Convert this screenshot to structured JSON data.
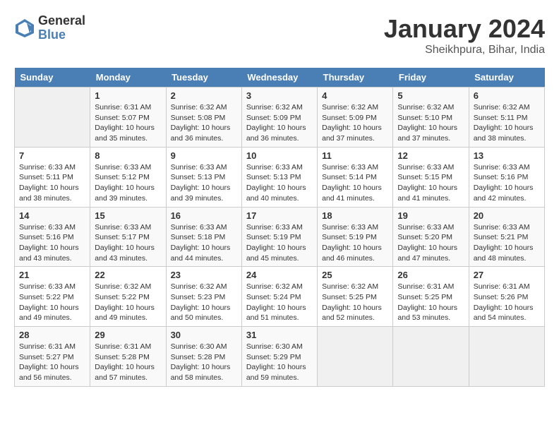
{
  "header": {
    "logo_general": "General",
    "logo_blue": "Blue",
    "month_year": "January 2024",
    "location": "Sheikhpura, Bihar, India"
  },
  "calendar": {
    "days_of_week": [
      "Sunday",
      "Monday",
      "Tuesday",
      "Wednesday",
      "Thursday",
      "Friday",
      "Saturday"
    ],
    "weeks": [
      [
        {
          "day": "",
          "info": ""
        },
        {
          "day": "1",
          "info": "Sunrise: 6:31 AM\nSunset: 5:07 PM\nDaylight: 10 hours\nand 35 minutes."
        },
        {
          "day": "2",
          "info": "Sunrise: 6:32 AM\nSunset: 5:08 PM\nDaylight: 10 hours\nand 36 minutes."
        },
        {
          "day": "3",
          "info": "Sunrise: 6:32 AM\nSunset: 5:09 PM\nDaylight: 10 hours\nand 36 minutes."
        },
        {
          "day": "4",
          "info": "Sunrise: 6:32 AM\nSunset: 5:09 PM\nDaylight: 10 hours\nand 37 minutes."
        },
        {
          "day": "5",
          "info": "Sunrise: 6:32 AM\nSunset: 5:10 PM\nDaylight: 10 hours\nand 37 minutes."
        },
        {
          "day": "6",
          "info": "Sunrise: 6:32 AM\nSunset: 5:11 PM\nDaylight: 10 hours\nand 38 minutes."
        }
      ],
      [
        {
          "day": "7",
          "info": "Sunrise: 6:33 AM\nSunset: 5:11 PM\nDaylight: 10 hours\nand 38 minutes."
        },
        {
          "day": "8",
          "info": "Sunrise: 6:33 AM\nSunset: 5:12 PM\nDaylight: 10 hours\nand 39 minutes."
        },
        {
          "day": "9",
          "info": "Sunrise: 6:33 AM\nSunset: 5:13 PM\nDaylight: 10 hours\nand 39 minutes."
        },
        {
          "day": "10",
          "info": "Sunrise: 6:33 AM\nSunset: 5:13 PM\nDaylight: 10 hours\nand 40 minutes."
        },
        {
          "day": "11",
          "info": "Sunrise: 6:33 AM\nSunset: 5:14 PM\nDaylight: 10 hours\nand 41 minutes."
        },
        {
          "day": "12",
          "info": "Sunrise: 6:33 AM\nSunset: 5:15 PM\nDaylight: 10 hours\nand 41 minutes."
        },
        {
          "day": "13",
          "info": "Sunrise: 6:33 AM\nSunset: 5:16 PM\nDaylight: 10 hours\nand 42 minutes."
        }
      ],
      [
        {
          "day": "14",
          "info": "Sunrise: 6:33 AM\nSunset: 5:16 PM\nDaylight: 10 hours\nand 43 minutes."
        },
        {
          "day": "15",
          "info": "Sunrise: 6:33 AM\nSunset: 5:17 PM\nDaylight: 10 hours\nand 43 minutes."
        },
        {
          "day": "16",
          "info": "Sunrise: 6:33 AM\nSunset: 5:18 PM\nDaylight: 10 hours\nand 44 minutes."
        },
        {
          "day": "17",
          "info": "Sunrise: 6:33 AM\nSunset: 5:19 PM\nDaylight: 10 hours\nand 45 minutes."
        },
        {
          "day": "18",
          "info": "Sunrise: 6:33 AM\nSunset: 5:19 PM\nDaylight: 10 hours\nand 46 minutes."
        },
        {
          "day": "19",
          "info": "Sunrise: 6:33 AM\nSunset: 5:20 PM\nDaylight: 10 hours\nand 47 minutes."
        },
        {
          "day": "20",
          "info": "Sunrise: 6:33 AM\nSunset: 5:21 PM\nDaylight: 10 hours\nand 48 minutes."
        }
      ],
      [
        {
          "day": "21",
          "info": "Sunrise: 6:33 AM\nSunset: 5:22 PM\nDaylight: 10 hours\nand 49 minutes."
        },
        {
          "day": "22",
          "info": "Sunrise: 6:32 AM\nSunset: 5:22 PM\nDaylight: 10 hours\nand 49 minutes."
        },
        {
          "day": "23",
          "info": "Sunrise: 6:32 AM\nSunset: 5:23 PM\nDaylight: 10 hours\nand 50 minutes."
        },
        {
          "day": "24",
          "info": "Sunrise: 6:32 AM\nSunset: 5:24 PM\nDaylight: 10 hours\nand 51 minutes."
        },
        {
          "day": "25",
          "info": "Sunrise: 6:32 AM\nSunset: 5:25 PM\nDaylight: 10 hours\nand 52 minutes."
        },
        {
          "day": "26",
          "info": "Sunrise: 6:31 AM\nSunset: 5:25 PM\nDaylight: 10 hours\nand 53 minutes."
        },
        {
          "day": "27",
          "info": "Sunrise: 6:31 AM\nSunset: 5:26 PM\nDaylight: 10 hours\nand 54 minutes."
        }
      ],
      [
        {
          "day": "28",
          "info": "Sunrise: 6:31 AM\nSunset: 5:27 PM\nDaylight: 10 hours\nand 56 minutes."
        },
        {
          "day": "29",
          "info": "Sunrise: 6:31 AM\nSunset: 5:28 PM\nDaylight: 10 hours\nand 57 minutes."
        },
        {
          "day": "30",
          "info": "Sunrise: 6:30 AM\nSunset: 5:28 PM\nDaylight: 10 hours\nand 58 minutes."
        },
        {
          "day": "31",
          "info": "Sunrise: 6:30 AM\nSunset: 5:29 PM\nDaylight: 10 hours\nand 59 minutes."
        },
        {
          "day": "",
          "info": ""
        },
        {
          "day": "",
          "info": ""
        },
        {
          "day": "",
          "info": ""
        }
      ]
    ]
  }
}
